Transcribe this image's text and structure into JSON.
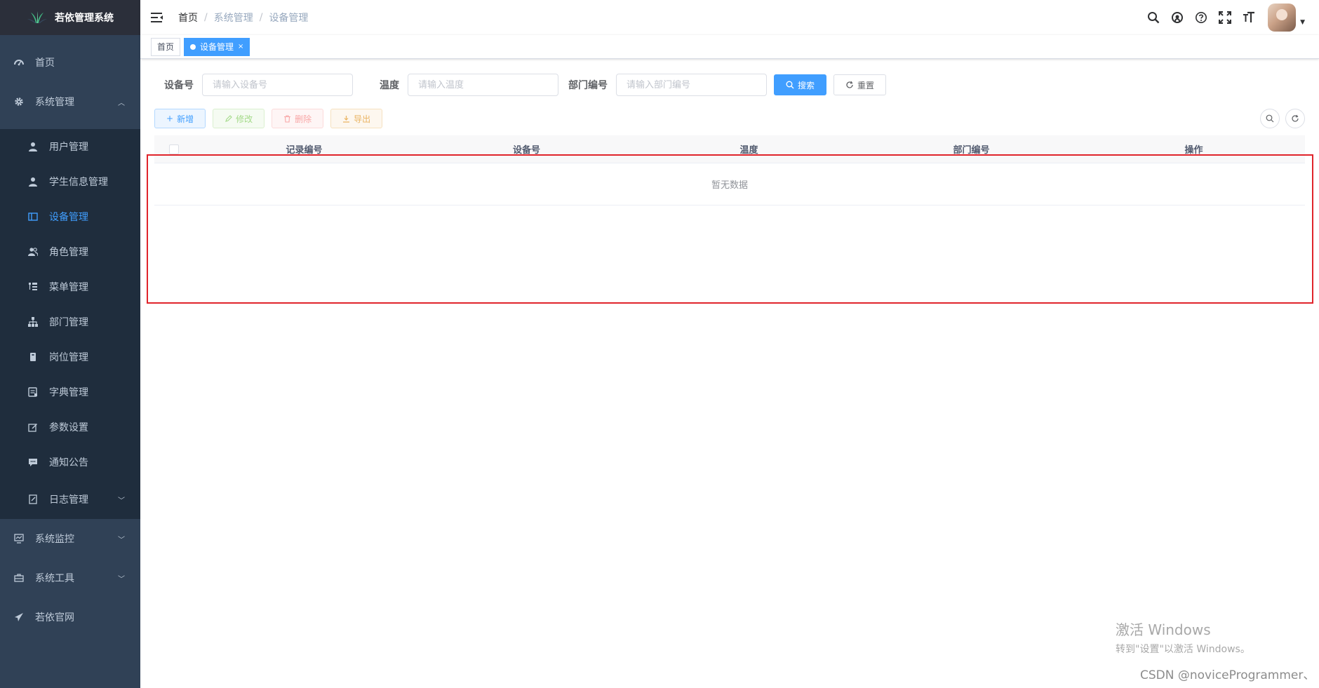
{
  "app": {
    "title": "若依管理系统"
  },
  "sidebar": {
    "items": [
      {
        "label": "首页",
        "icon": "dashboard-icon"
      },
      {
        "label": "系统管理",
        "icon": "gear-icon",
        "expanded": true,
        "children": [
          {
            "label": "用户管理",
            "icon": "user-icon"
          },
          {
            "label": "学生信息管理",
            "icon": "user-icon"
          },
          {
            "label": "设备管理",
            "icon": "device-icon",
            "active": true
          },
          {
            "label": "角色管理",
            "icon": "peoples-icon"
          },
          {
            "label": "菜单管理",
            "icon": "tree-table-icon"
          },
          {
            "label": "部门管理",
            "icon": "tree-icon"
          },
          {
            "label": "岗位管理",
            "icon": "post-icon"
          },
          {
            "label": "字典管理",
            "icon": "dict-icon"
          },
          {
            "label": "参数设置",
            "icon": "edit-icon"
          },
          {
            "label": "通知公告",
            "icon": "message-icon"
          },
          {
            "label": "日志管理",
            "icon": "log-icon"
          }
        ]
      },
      {
        "label": "系统监控",
        "icon": "monitor-icon"
      },
      {
        "label": "系统工具",
        "icon": "tool-icon"
      },
      {
        "label": "若依官网",
        "icon": "guide-icon"
      }
    ]
  },
  "breadcrumb": [
    "首页",
    "系统管理",
    "设备管理"
  ],
  "tags": [
    {
      "label": "首页",
      "active": false
    },
    {
      "label": "设备管理",
      "active": true,
      "close": "×"
    }
  ],
  "search": {
    "fields": [
      {
        "label": "设备号",
        "placeholder": "请输入设备号"
      },
      {
        "label": "温度",
        "placeholder": "请输入温度"
      },
      {
        "label": "部门编号",
        "placeholder": "请输入部门编号"
      }
    ],
    "search_label": "搜索",
    "reset_label": "重置"
  },
  "toolbar": {
    "add": "新增",
    "edit": "修改",
    "delete": "删除",
    "export": "导出"
  },
  "table": {
    "columns": [
      "记录编号",
      "设备号",
      "温度",
      "部门编号",
      "操作"
    ],
    "empty_text": "暂无数据"
  },
  "watermark": {
    "line1": "激活 Windows",
    "line2": "转到\"设置\"以激活 Windows。"
  },
  "credit": "CSDN @noviceProgrammer、",
  "colors": {
    "sidebar_bg": "#304156",
    "primary": "#409eff",
    "highlight": "#e0242b"
  }
}
